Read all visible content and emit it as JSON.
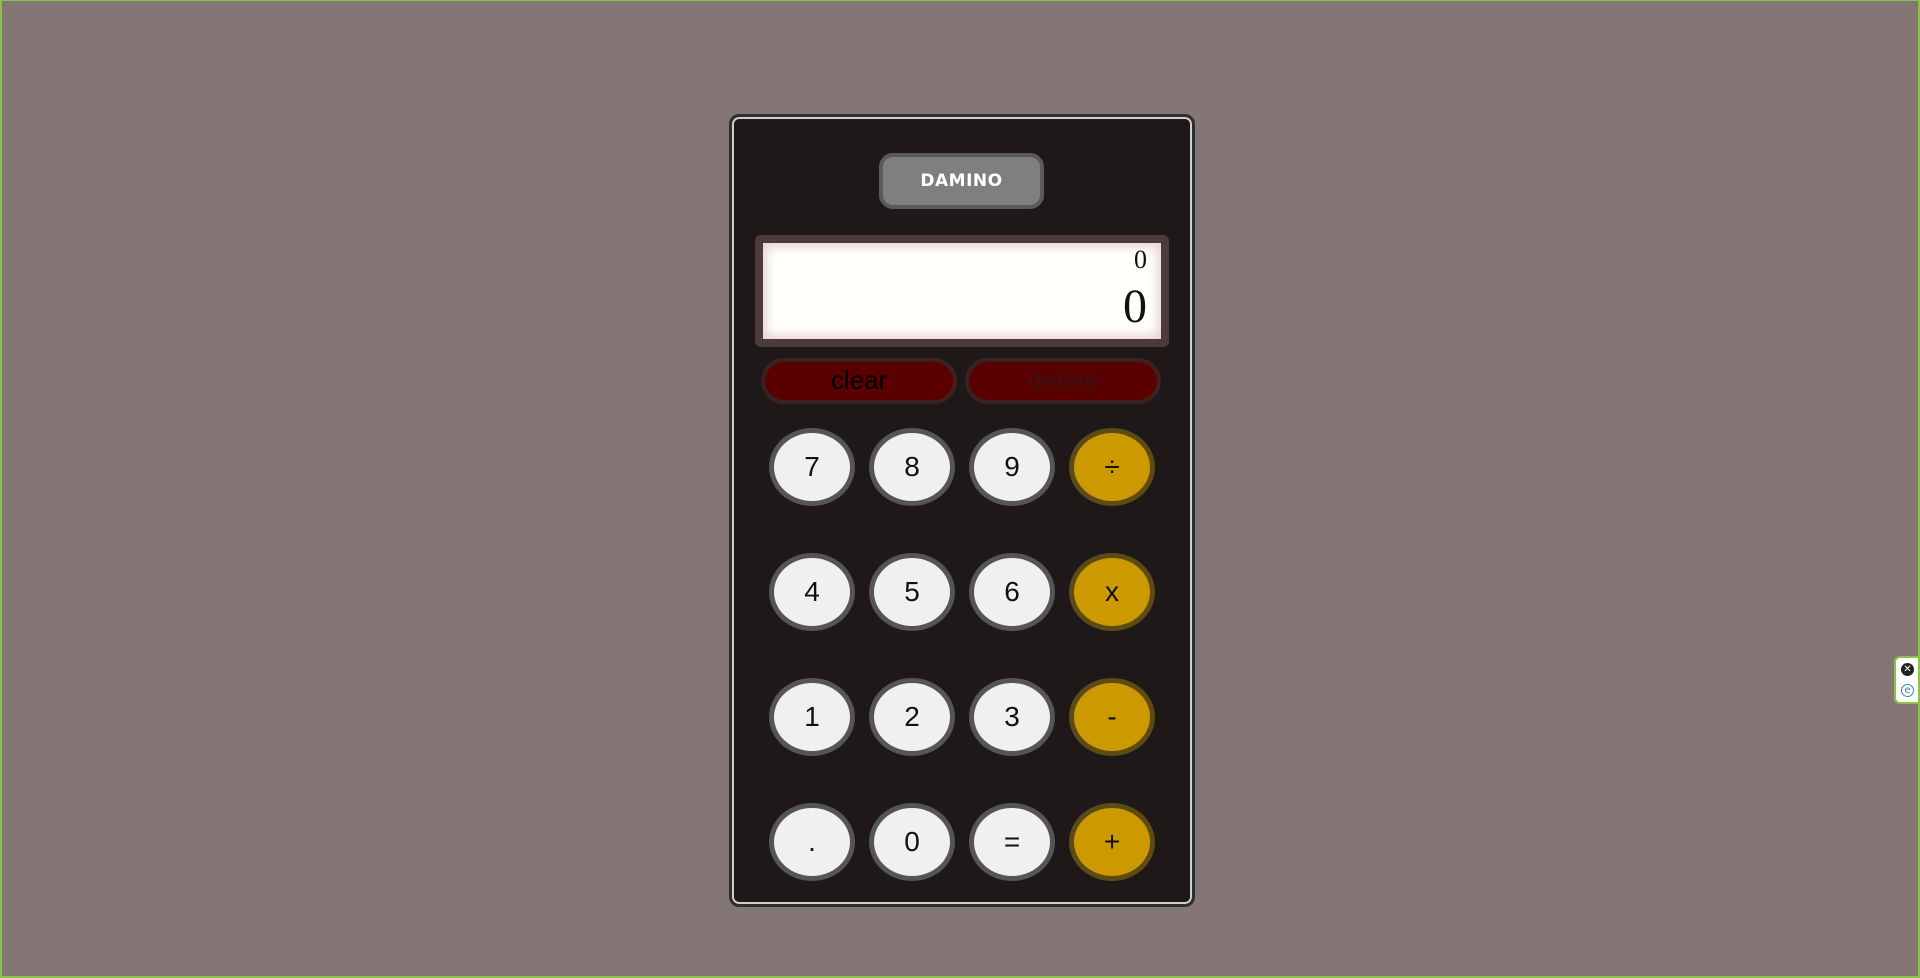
{
  "brand": {
    "label": "DAMINO"
  },
  "display": {
    "previous": "0",
    "current": "0"
  },
  "actions": {
    "clear_label": "clear",
    "delete_label": "delete"
  },
  "keys": {
    "seven": "7",
    "eight": "8",
    "nine": "9",
    "divide": "÷",
    "four": "4",
    "five": "5",
    "six": "6",
    "multiply": "x",
    "one": "1",
    "two": "2",
    "three": "3",
    "subtract": "-",
    "decimal": ".",
    "zero": "0",
    "equals": "=",
    "add": "+"
  },
  "side_widget": {
    "close_icon": "✕",
    "extension_icon": "e"
  },
  "colors": {
    "background": "#847675",
    "calculator_body": "#1e1918",
    "operator_key": "#cc9900",
    "number_key": "#f0f0f0",
    "action_button": "#5a0000"
  }
}
